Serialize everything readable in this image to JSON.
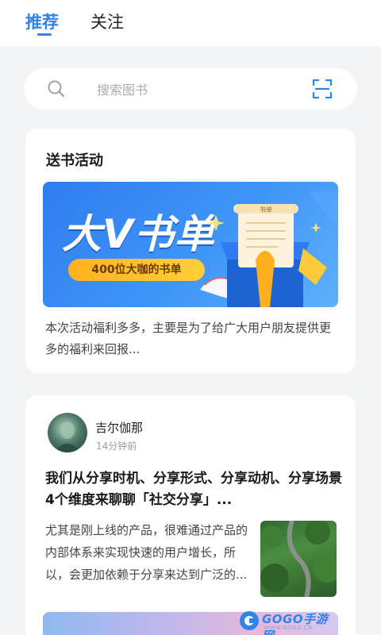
{
  "tabs": [
    {
      "label": "推荐",
      "active": true
    },
    {
      "label": "关注",
      "active": false
    }
  ],
  "search": {
    "placeholder": "搜索图书"
  },
  "activity": {
    "title": "送书活动",
    "banner_title": "大V书单",
    "banner_pill": "400位大咖的书单",
    "banner_scroll_text": "书单",
    "description": "本次活动福利多多，主要是为了给广大用户朋友提供更多的福利来回报..."
  },
  "post": {
    "author": "吉尔伽那",
    "time": "14分钟前",
    "title": "我们从分享时机、分享形式、分享动机、分享场景4个维度来聊聊「社交分享」...",
    "excerpt": "尤其是刚上线的产品，很难通过产品的内部体系来实现快速的用户增长，所以，会更加依赖于分享来达到广泛的..."
  },
  "watermark": {
    "text": "GOGO手游网",
    "sub": "WWW.GOGO.CN"
  },
  "colors": {
    "accent": "#2f84ea",
    "background": "#f2f4f7",
    "card": "#ffffff"
  }
}
